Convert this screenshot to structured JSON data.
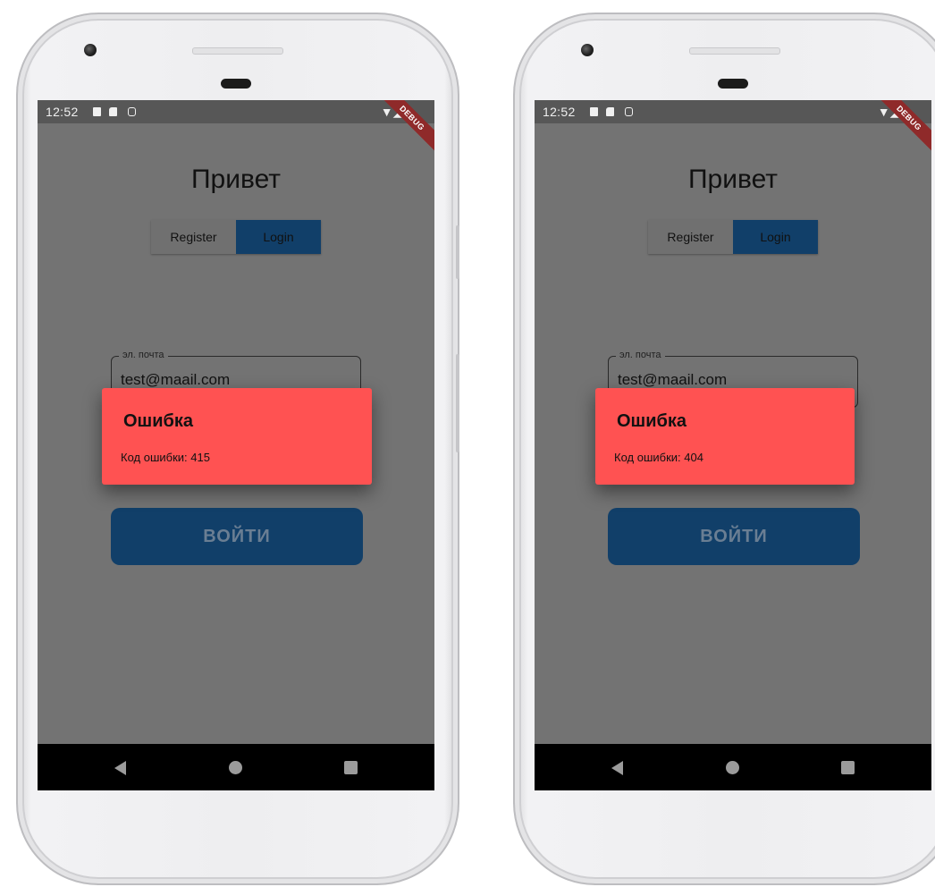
{
  "phones": [
    {
      "status": {
        "time": "12:52",
        "right_icons": "▼◢ ▮",
        "debug_banner": "DEBUG"
      },
      "greeting": "Привет",
      "toggle": {
        "register": "Register",
        "login": "Login"
      },
      "email": {
        "label": "эл. почта",
        "value": "test@maail.com"
      },
      "submit": "ВОЙТИ",
      "dialog": {
        "title": "Ошибка",
        "message": "Код ошибки: 415"
      }
    },
    {
      "status": {
        "time": "12:52",
        "right_icons": "▼◢ ▮",
        "debug_banner": "DEBUG"
      },
      "greeting": "Привет",
      "toggle": {
        "register": "Register",
        "login": "Login"
      },
      "email": {
        "label": "эл. почта",
        "value": "test@maail.com"
      },
      "submit": "ВОЙТИ",
      "dialog": {
        "title": "Ошибка",
        "message": "Код ошибки: 404"
      }
    }
  ],
  "colors": {
    "screen_overlay": "#737373",
    "dialog_bg": "#ff5252",
    "primary_button": "#113f69",
    "statusbar": "#575757",
    "navbar": "#000000"
  }
}
